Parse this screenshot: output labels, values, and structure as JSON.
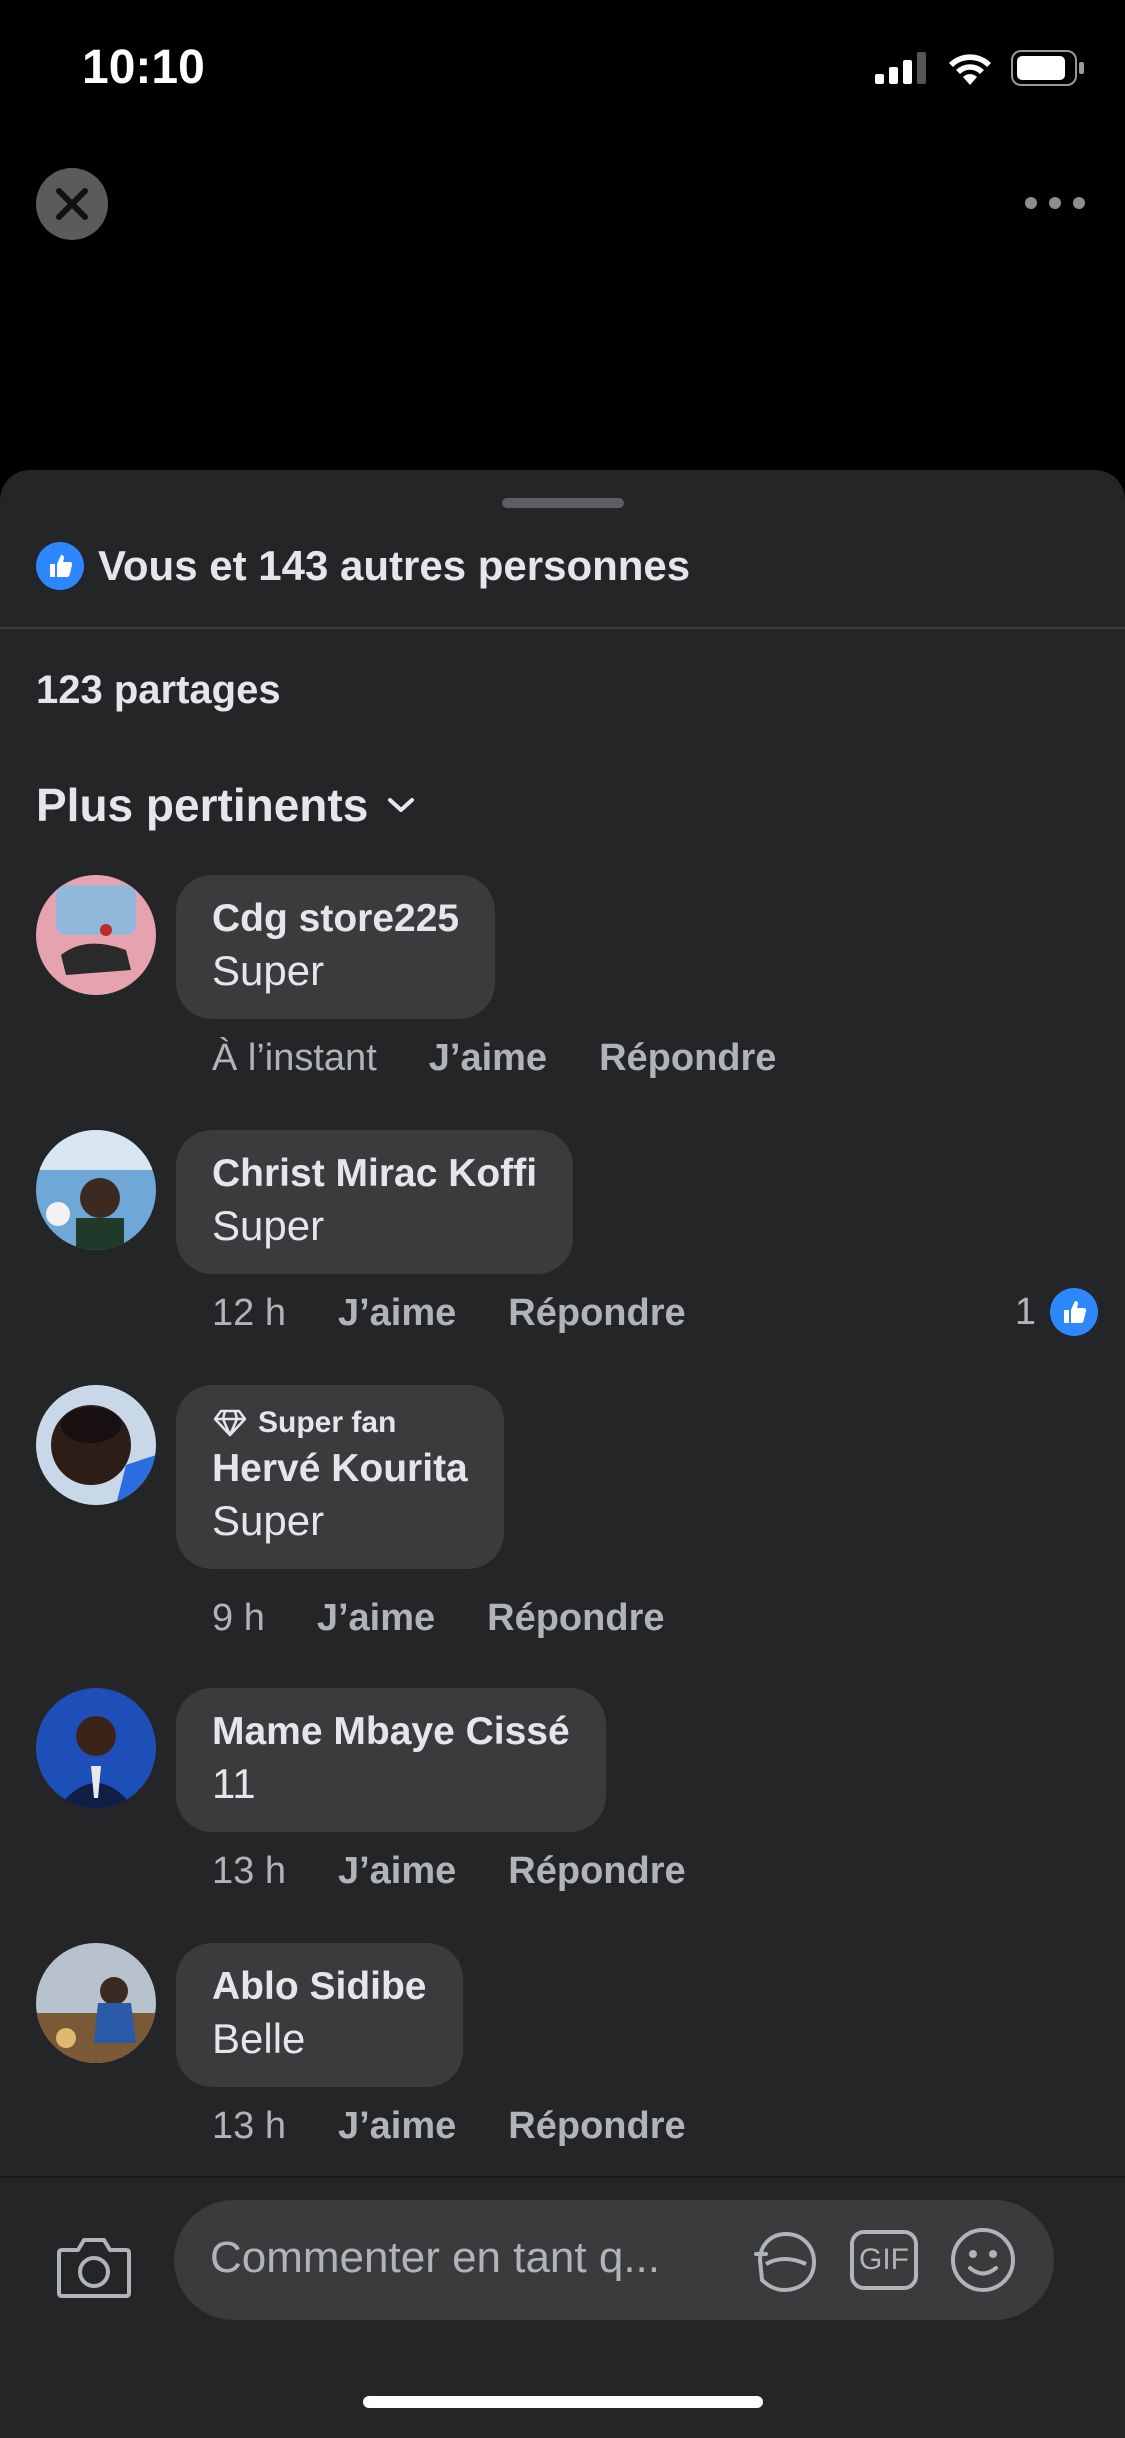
{
  "status_bar": {
    "time": "10:10"
  },
  "header": {
    "close_icon": "close-icon",
    "more_icon": "more-horizontal-icon"
  },
  "reactions": {
    "icon": "like-icon",
    "text": "Vous et 143 autres personnes"
  },
  "shares": "123 partages",
  "sort": {
    "label": "Plus pertinents",
    "icon": "chevron-down-icon"
  },
  "comments": [
    {
      "name": "Cdg store225",
      "text": "Super",
      "time": "À l’instant",
      "like": "J’aime",
      "reply": "Répondre"
    },
    {
      "name": "Christ Mirac Koffi",
      "text": "Super",
      "time": "12 h",
      "like": "J’aime",
      "reply": "Répondre",
      "likes": "1"
    },
    {
      "badge": "Super fan",
      "name": "Hervé Kourita",
      "text": "Super",
      "time": "9 h",
      "like": "J’aime",
      "reply": "Répondre"
    },
    {
      "name": "Mame Mbaye Cissé",
      "text": "11",
      "time": "13 h",
      "like": "J’aime",
      "reply": "Répondre"
    },
    {
      "name": "Ablo Sidibe",
      "text": "Belle",
      "time": "13 h",
      "like": "J’aime",
      "reply": "Répondre"
    }
  ],
  "composer": {
    "placeholder": "Commenter en tant q...",
    "gif_label": "GIF"
  },
  "colors": {
    "accent": "#2d88ff",
    "sheet": "#242526",
    "bubble": "#3a3b3c"
  }
}
